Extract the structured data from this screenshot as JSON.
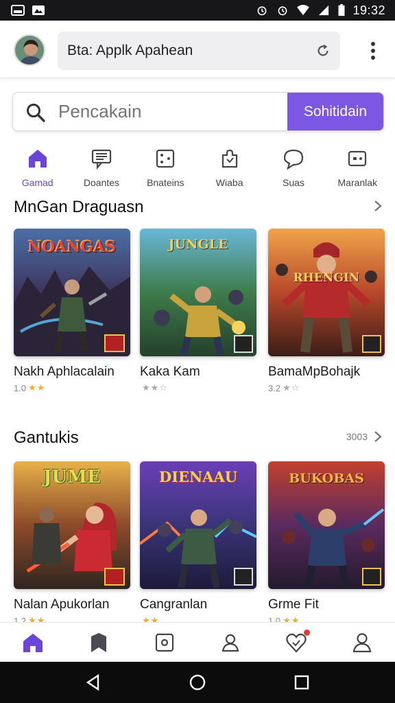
{
  "status_bar": {
    "time": "19:32"
  },
  "header": {
    "url_text": "Bta: Applk Apahean"
  },
  "search": {
    "placeholder": "Pencakain",
    "button_label": "Sohitidain"
  },
  "categories": [
    {
      "label": "Gamad",
      "icon": "home-icon",
      "active": true
    },
    {
      "label": "Doantes",
      "icon": "chat-icon",
      "active": false
    },
    {
      "label": "Bnateins",
      "icon": "dice-icon",
      "active": false
    },
    {
      "label": "Wiaba",
      "icon": "puzzle-icon",
      "active": false
    },
    {
      "label": "Suas",
      "icon": "speech-bubble-icon",
      "active": false
    },
    {
      "label": "Maranlak",
      "icon": "gamepad-icon",
      "active": false
    }
  ],
  "sections": [
    {
      "title": "MnGan Draguasn",
      "see_all": "",
      "items": [
        {
          "title": "Nakh Aphlacalain",
          "rating": "1.0",
          "art_text": "NOANGAS"
        },
        {
          "title": "Kaka Kam",
          "rating": "",
          "art_text": "JUNGLE"
        },
        {
          "title": "BamaMpBohajk",
          "rating": "3.2",
          "art_text": "RHENGIN"
        }
      ]
    },
    {
      "title": "Gantukis",
      "see_all": "3003",
      "items": [
        {
          "title": "Nalan Apukorlan",
          "rating": "1.2",
          "art_text": "JUME"
        },
        {
          "title": "Cangranlan",
          "rating": "",
          "art_text": "DIENAAU"
        },
        {
          "title": "Grme Fit",
          "rating": "1.0",
          "art_text": "BUKOBAS"
        }
      ]
    }
  ],
  "bottom_nav": [
    {
      "icon": "home-icon",
      "active": true
    },
    {
      "icon": "bookmark-icon",
      "active": false
    },
    {
      "icon": "game-icon",
      "active": false
    },
    {
      "icon": "profile-bell-icon",
      "active": false
    },
    {
      "icon": "heart-icon",
      "active": false,
      "badge": true
    },
    {
      "icon": "user-icon",
      "active": false
    }
  ],
  "colors": {
    "accent": "#7b57e4",
    "star": "#f2b01e"
  }
}
